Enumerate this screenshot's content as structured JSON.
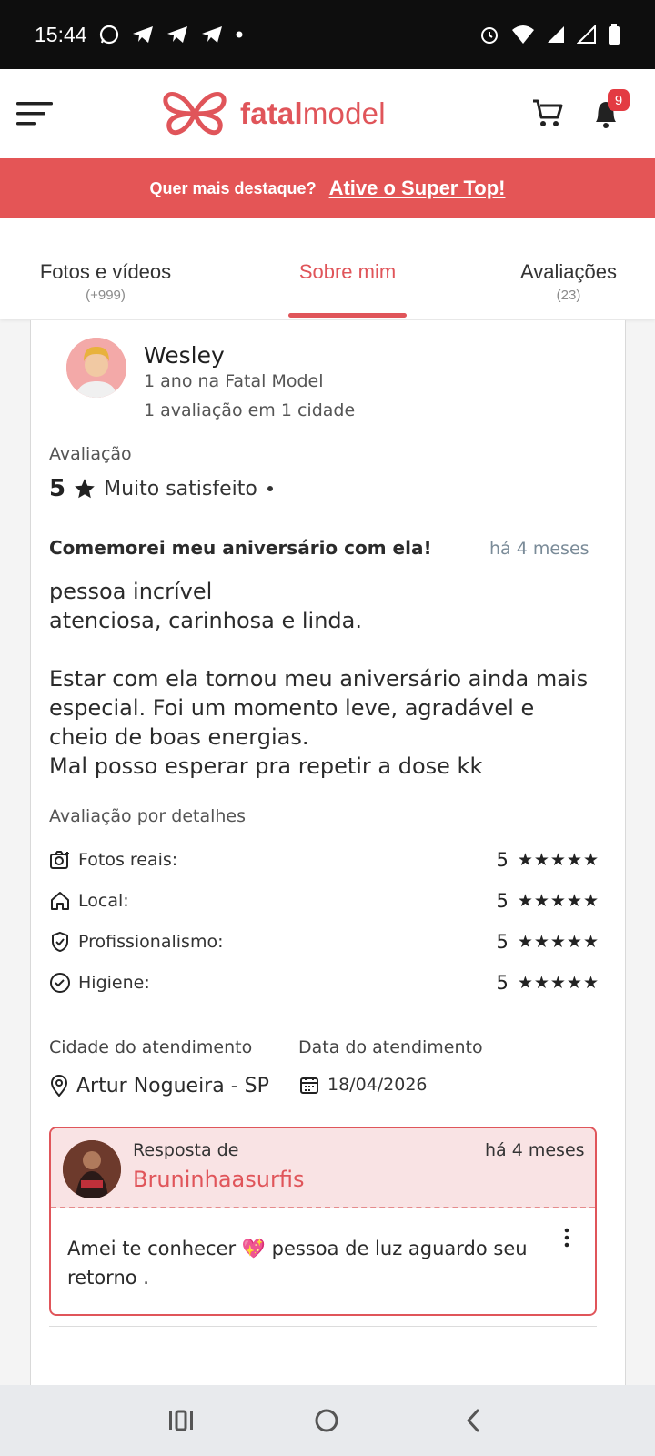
{
  "status": {
    "time": "15:44"
  },
  "header": {
    "logo_bold": "fatal",
    "logo_light": "model",
    "notification_count": "9"
  },
  "promo": {
    "text": "Quer mais destaque?",
    "link": "Ative o Super Top!"
  },
  "tabs": [
    {
      "label": "Fotos e vídeos",
      "count": "(+999)"
    },
    {
      "label": "Sobre mim",
      "count": ""
    },
    {
      "label": "Avaliações",
      "count": "(23)"
    }
  ],
  "review": {
    "user_name": "Wesley",
    "user_tenure": "1 ano na Fatal Model",
    "user_stats": "1 avaliação em 1 cidade",
    "rating_label": "Avaliação",
    "rating_value": "5",
    "rating_text": "Muito satisfeito",
    "title": "Comemorei meu aniversário com ela!",
    "time": "há 4 meses",
    "body": "pessoa incrível\natenciosa, carinhosa e linda.\n\nEstar com ela tornou meu aniversário ainda mais especial. Foi um momento leve, agradável e cheio de boas energias.\nMal posso esperar pra repetir a dose kk",
    "details_label": "Avaliação por detalhes",
    "details": [
      {
        "icon": "camera-icon",
        "label": "Fotos reais:",
        "score": "5",
        "stars": "★★★★★"
      },
      {
        "icon": "home-icon",
        "label": "Local:",
        "score": "5",
        "stars": "★★★★★"
      },
      {
        "icon": "shield-check-icon",
        "label": "Profissionalismo:",
        "score": "5",
        "stars": "★★★★★"
      },
      {
        "icon": "check-circle-icon",
        "label": "Higiene:",
        "score": "5",
        "stars": "★★★★★"
      }
    ],
    "city_label": "Cidade do atendimento",
    "city": "Artur Nogueira - SP",
    "date_label": "Data do atendimento",
    "date": "18/04/2026"
  },
  "reply": {
    "from_label": "Resposta de",
    "name": "Bruninhaasurfis",
    "time": "há 4 meses",
    "body": "Amei te conhecer 💖 pessoa de luz aguardo seu retorno ."
  },
  "colors": {
    "accent": "#e0555a",
    "promo_bg": "#e45556",
    "reply_bg": "#f9e3e4"
  }
}
